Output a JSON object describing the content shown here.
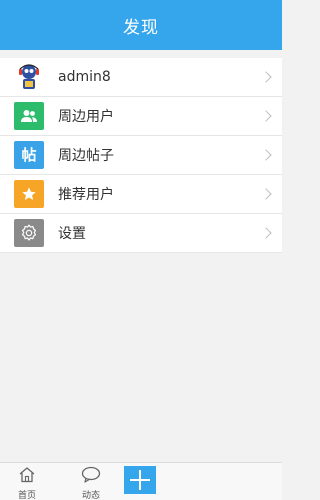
{
  "header": {
    "title": "发现"
  },
  "menu": {
    "items": [
      {
        "label": "admin8",
        "icon": "user-avatar-icon",
        "color": "#ffffff"
      },
      {
        "label": "周边用户",
        "icon": "people-icon",
        "color": "#2dbb6c"
      },
      {
        "label": "周边帖子",
        "icon": "post-icon",
        "color": "#3aa3e8",
        "icon_text": "帖"
      },
      {
        "label": "推荐用户",
        "icon": "star-icon",
        "color": "#f7a526"
      },
      {
        "label": "设置",
        "icon": "gear-icon",
        "color": "#8a8a8a"
      }
    ]
  },
  "tabbar": {
    "home": {
      "label": "首页",
      "icon": "home-icon"
    },
    "feed": {
      "label": "动态",
      "icon": "chat-bubble-icon"
    },
    "add": {
      "icon": "plus-icon"
    }
  },
  "colors": {
    "accent": "#36a6ec"
  }
}
